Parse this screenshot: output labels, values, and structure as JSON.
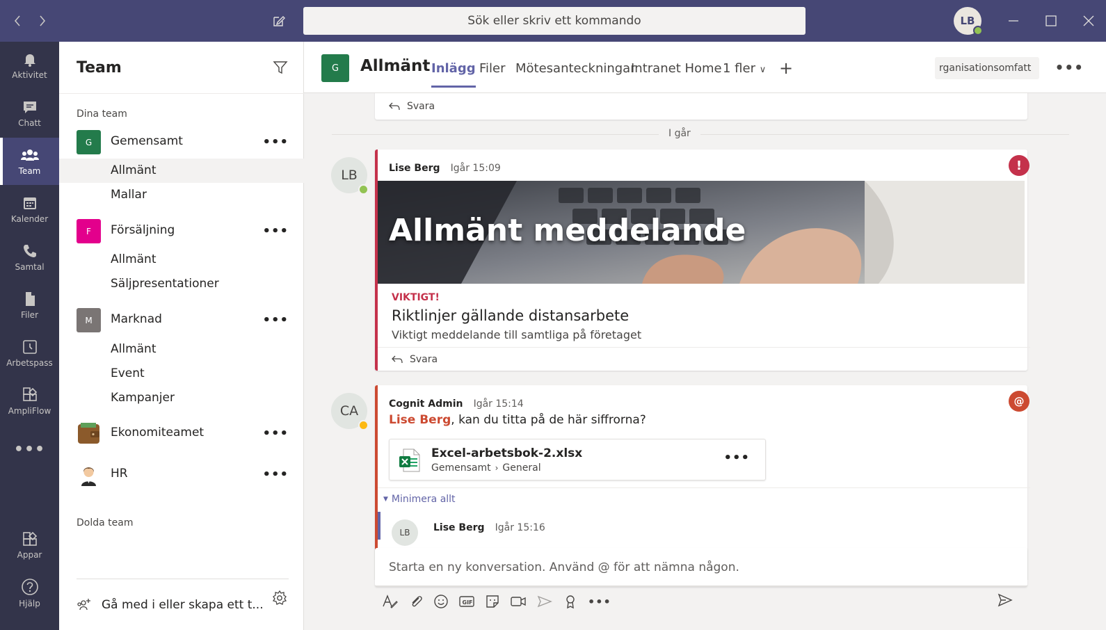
{
  "titlebar": {
    "search_placeholder": "Sök eller skriv ett kommando",
    "user_initials": "LB"
  },
  "rail": {
    "items": [
      {
        "label": "Aktivitet",
        "icon": "bell-icon"
      },
      {
        "label": "Chatt",
        "icon": "chat-icon"
      },
      {
        "label": "Team",
        "icon": "team-icon",
        "active": true
      },
      {
        "label": "Kalender",
        "icon": "calendar-icon"
      },
      {
        "label": "Samtal",
        "icon": "phone-icon"
      },
      {
        "label": "Filer",
        "icon": "file-icon"
      },
      {
        "label": "Arbetspass",
        "icon": "clock-icon"
      },
      {
        "label": "AmpliFlow",
        "icon": "ampliflow-icon"
      },
      {
        "label": "Appar",
        "icon": "apps-icon"
      },
      {
        "label": "Hjälp",
        "icon": "help-icon"
      }
    ]
  },
  "teams_pane": {
    "title": "Team",
    "your_teams_label": "Dina team",
    "hidden_teams_label": "Dolda team",
    "join_create_label": "Gå med i eller skapa ett t...",
    "teams": [
      {
        "name": "Gemensamt",
        "initial": "G",
        "color": "#237b4b",
        "channels": [
          "Allmänt",
          "Mallar"
        ]
      },
      {
        "name": "Försäljning",
        "initial": "F",
        "color": "#e3008c",
        "channels": [
          "Allmänt",
          "Säljpresentationer"
        ]
      },
      {
        "name": "Marknad",
        "initial": "M",
        "color": "#7a7574",
        "channels": [
          "Allmänt",
          "Event",
          "Kampanjer"
        ]
      },
      {
        "name": "Ekonomiteamet",
        "icon": "wallet-icon",
        "channels": []
      },
      {
        "name": "HR",
        "icon": "person-icon",
        "channels": []
      }
    ]
  },
  "channel_header": {
    "initial": "G",
    "title": "Allmänt",
    "tabs": [
      "Inlägg",
      "Filer",
      "Mötesanteckningar",
      "Intranet Home",
      "1 fler"
    ],
    "active_tab": "Inlägg",
    "org_button": "rganisationsomfatt"
  },
  "feed": {
    "reply_label": "Svara",
    "day_divider": "I går",
    "post1": {
      "initials": "LB",
      "author": "Lise Berg",
      "time": "Igår 15:09",
      "hero_title": "Allmänt meddelande",
      "importance_label": "VIKTIGT!",
      "headline": "Riktlinjer gällande distansarbete",
      "description": "Viktigt meddelande till samtliga på företaget"
    },
    "post2": {
      "initials": "CA",
      "author": "Cognit Admin",
      "time": "Igår 15:14",
      "mention": "Lise Berg",
      "body": ", kan du titta på de här siffrorna?",
      "file_name": "Excel-arbetsbok-2.xlsx",
      "file_team": "Gemensamt",
      "file_folder": "General",
      "collapse_label": "Minimera allt",
      "reply_initials": "LB",
      "reply_author": "Lise Berg",
      "reply_time": "Igår 15:16"
    }
  },
  "compose": {
    "placeholder": "Starta en ny konversation. Använd @ för att nämna någon."
  },
  "colors": {
    "brand": "#6264a7",
    "titlebar": "#464775",
    "rail": "#33344a",
    "important": "#c4314b",
    "mention": "#cc4a31"
  }
}
